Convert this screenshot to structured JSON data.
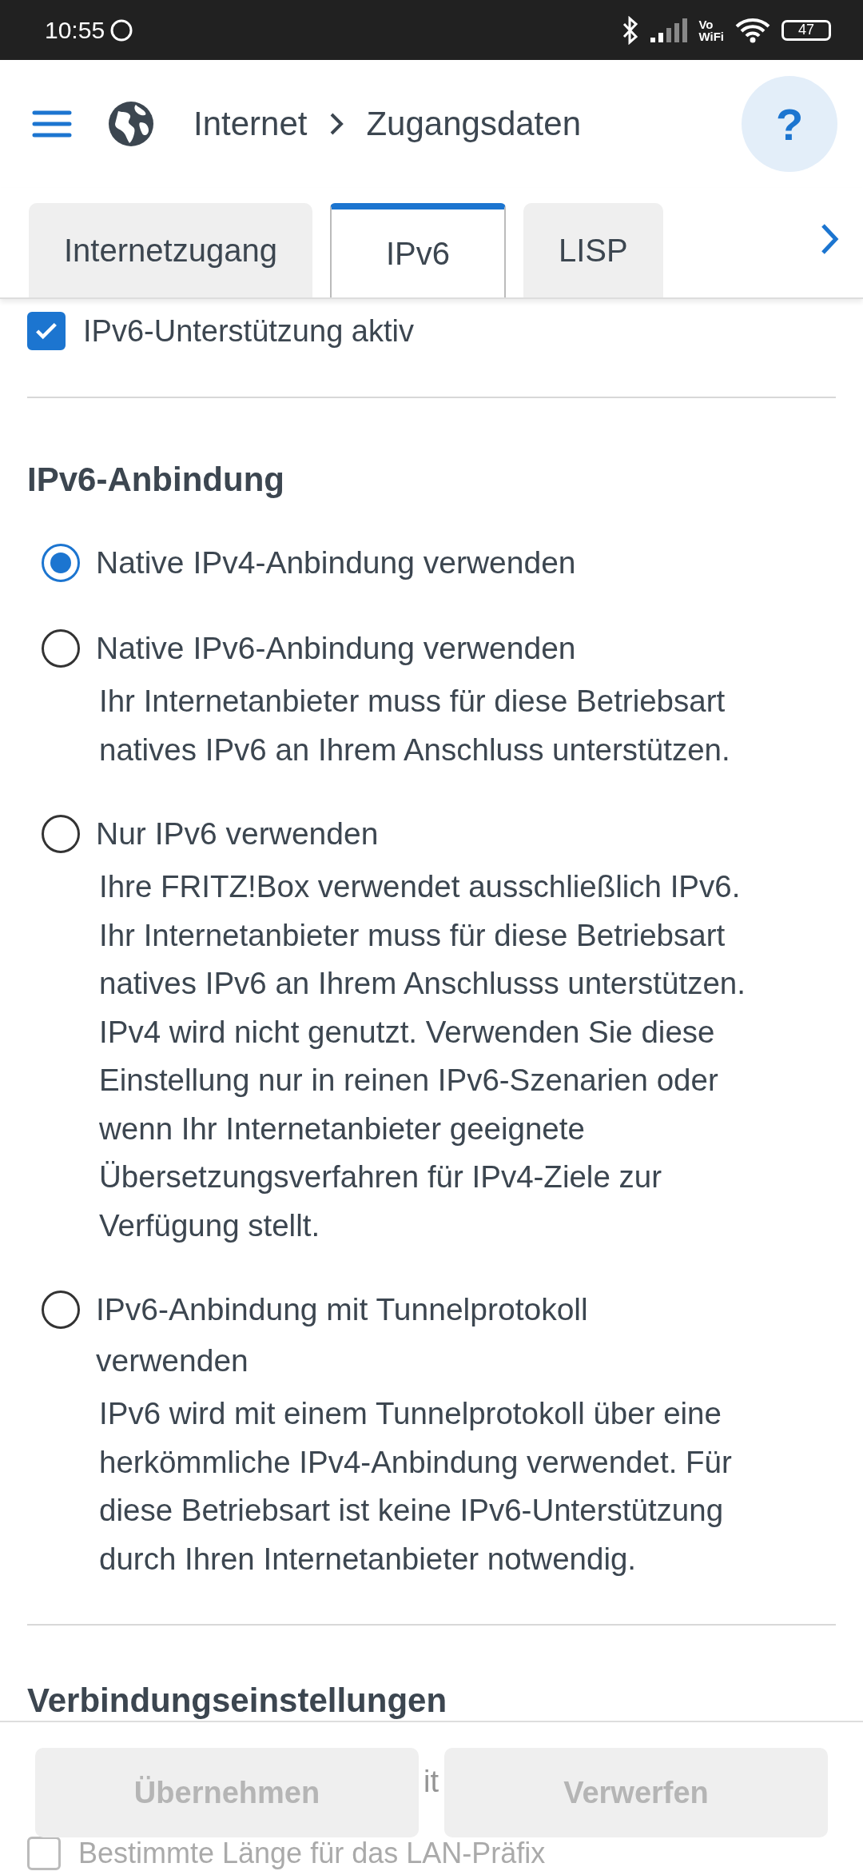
{
  "status_bar": {
    "time": "10:55",
    "vowifi_top": "Vo",
    "vowifi_bottom": "WiFi",
    "battery": "47"
  },
  "header": {
    "breadcrumb": [
      "Internet",
      "Zugangsdaten"
    ],
    "help": "?"
  },
  "tabs": [
    {
      "label": "Internetzugang",
      "selected": false
    },
    {
      "label": "IPv6",
      "selected": true
    },
    {
      "label": "LISP",
      "selected": false
    }
  ],
  "ipv6_support": {
    "label": "IPv6-Unterstützung aktiv",
    "checked": true
  },
  "section_title": "IPv6-Anbindung",
  "options": [
    {
      "label": "Native IPv4-Anbindung verwenden",
      "selected": true
    },
    {
      "label": "Native IPv6-Anbindung verwenden",
      "selected": false,
      "description": "Ihr Internetanbieter muss für diese Betriebsart natives IPv6 an Ihrem Anschluss unterstützen."
    },
    {
      "label": "Nur IPv6 verwenden",
      "selected": false,
      "description": "Ihre FRITZ!Box verwendet ausschließlich IPv6. Ihr Internetanbieter muss für diese Betriebsart natives IPv6 an Ihrem Anschlusss unterstützen. IPv4 wird nicht genutzt. Verwenden Sie diese Einstellung nur in reinen IPv6-Szenarien oder wenn Ihr Internetanbieter geeignete Übersetzungsverfahren für IPv4-Ziele zur Verfügung stellt."
    },
    {
      "label": "IPv6-Anbindung mit Tunnelprotokoll verwenden",
      "selected": false,
      "description": "IPv6 wird mit einem Tunnelprotokoll über eine herkömmliche IPv4-Anbindung verwendet. Für diese Betriebsart ist keine IPv6-Unterstützung durch Ihren Internetanbieter notwendig."
    }
  ],
  "connection_title": "Verbindungseinstellungen",
  "partial_text": "it",
  "lan_prefix": {
    "label": "Bestimmte Länge für das LAN-Präfix",
    "checked": false
  },
  "footer_buttons": [
    {
      "label": "Übernehmen",
      "disabled": true
    },
    {
      "label": "Verwerfen",
      "disabled": true
    }
  ]
}
